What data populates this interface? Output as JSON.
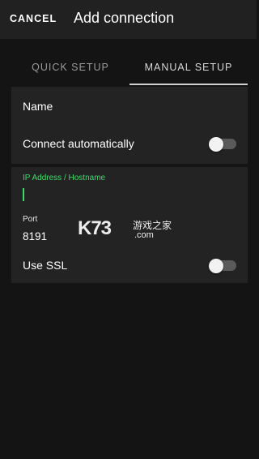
{
  "header": {
    "cancel_label": "CANCEL",
    "title": "Add connection"
  },
  "tabs": [
    {
      "label": "QUICK SETUP",
      "selected": false
    },
    {
      "label": "MANUAL SETUP",
      "selected": true
    }
  ],
  "connection": {
    "name_label": "Name",
    "auto_connect_label": "Connect automatically",
    "auto_connect_enabled": false
  },
  "server": {
    "ip_label": "IP Address / Hostname",
    "ip_value": "",
    "port_label": "Port",
    "port_value": "8191",
    "ssl_label": "Use SSL",
    "ssl_enabled": false
  },
  "watermark": {
    "brand": "K73",
    "cn": "游戏之家",
    "domain": ".com"
  },
  "colors": {
    "accent": "#3ddc6a",
    "background": "#141414",
    "card": "#232323",
    "topbar": "#212121"
  }
}
